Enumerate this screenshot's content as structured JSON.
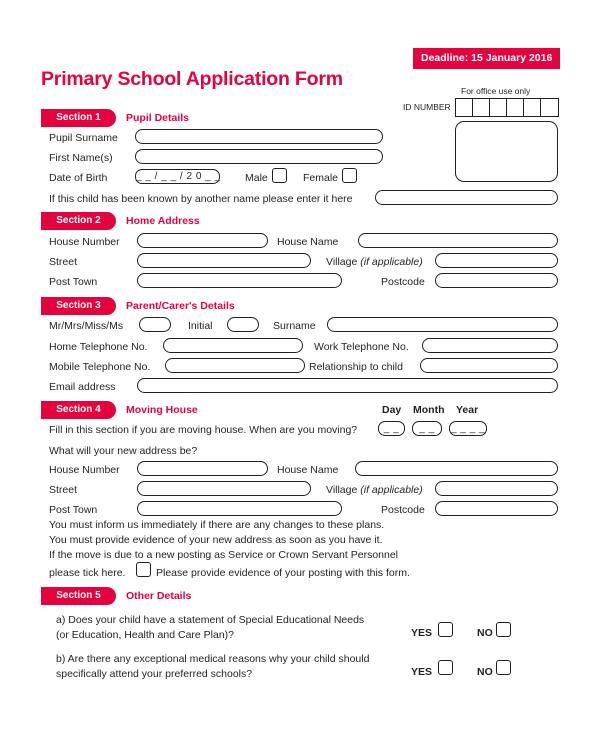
{
  "header": {
    "title": "Primary School Application Form",
    "deadline": "Deadline: 15 January 2016",
    "office_use_label": "For office use only",
    "id_number_label": "ID NUMBER",
    "id_cells": [
      "",
      "",
      "",
      "",
      "",
      ""
    ]
  },
  "colors": {
    "accent": "#e3033f",
    "text": "#231f20",
    "field_border": "#231f20"
  },
  "sections": [
    {
      "number": "Section 1",
      "name": "Pupil Details"
    },
    {
      "number": "Section 2",
      "name": "Home Address"
    },
    {
      "number": "Section 3",
      "name": "Parent/Carer's Details"
    },
    {
      "number": "Section 4",
      "name": "Moving House"
    },
    {
      "number": "Section 5",
      "name": "Other Details"
    }
  ],
  "section1": {
    "pupil_surname_label": "Pupil Surname",
    "pupil_surname_value": "",
    "first_names_label": "First Name(s)",
    "first_names_value": "",
    "dob_label": "Date of Birth",
    "dob_value": "_ _ / _ _ / 2 0 _ _",
    "male_label": "Male",
    "female_label": "Female",
    "known_as_label": "If this child has been known by another name please enter it here",
    "known_as_value": ""
  },
  "section2": {
    "house_number_label": "House Number",
    "house_number_value": "",
    "house_name_label": "House Name",
    "house_name_value": "",
    "street_label": "Street",
    "street_value": "",
    "village_label": "Village",
    "village_note": "(if applicable)",
    "village_value": "",
    "post_town_label": "Post Town",
    "post_town_value": "",
    "postcode_label": "Postcode",
    "postcode_value": ""
  },
  "section3": {
    "title_label": "Mr/Mrs/Miss/Ms",
    "title_value": "",
    "initial_label": "Initial",
    "initial_value": "",
    "surname_label": "Surname",
    "surname_value": "",
    "home_tel_label": "Home Telephone No.",
    "home_tel_value": "",
    "work_tel_label": "Work Telephone No.",
    "work_tel_value": "",
    "mobile_tel_label": "Mobile Telephone No.",
    "mobile_tel_value": "",
    "relationship_label": "Relationship to child",
    "relationship_value": "",
    "email_label": "Email address",
    "email_value": ""
  },
  "section4": {
    "day_label": "Day",
    "month_label": "Month",
    "year_label": "Year",
    "day_value": "_ _",
    "month_value": "_ _",
    "year_value": "_ _ _ _",
    "intro": "Fill in this section if you are moving house. When are you moving?",
    "new_address_question": "What will your new address be?",
    "house_number_label": "House Number",
    "house_number_value": "",
    "house_name_label": "House Name",
    "house_name_value": "",
    "street_label": "Street",
    "street_value": "",
    "village_label": "Village",
    "village_note": "(if applicable)",
    "village_value": "",
    "post_town_label": "Post Town",
    "post_town_value": "",
    "postcode_label": "Postcode",
    "postcode_value": "",
    "note_line1": "You must inform us immediately if there are any changes to these plans.",
    "note_line2": "You must provide evidence of your new address as soon as you have it.",
    "note_line3": "If the move is due to a new posting as Service or Crown Servant Personnel",
    "tick_prefix": "please tick here.",
    "tick_suffix": "Please provide evidence of your posting with this form."
  },
  "section5": {
    "question_a_line1": "a) Does your child have a statement of Special Educational Needs",
    "question_a_line2": "(or Education, Health and Care Plan)?",
    "question_b_line1": "b) Are there any exceptional medical reasons why your child should",
    "question_b_line2": "specifically attend your preferred schools?",
    "yes_label": "YES",
    "no_label": "NO"
  }
}
